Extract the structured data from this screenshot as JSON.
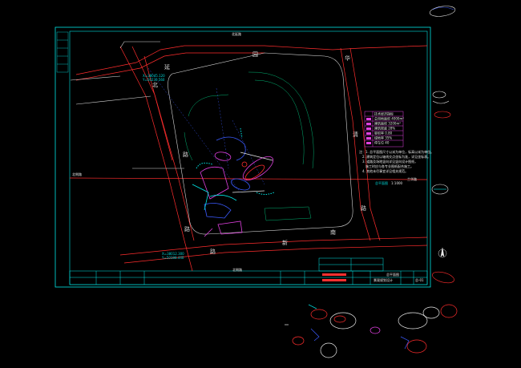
{
  "drawing": {
    "road_labels": [
      "北",
      "延",
      "园",
      "路",
      "华",
      "清",
      "路",
      "新",
      "路",
      "路",
      "南"
    ],
    "street_top": "北延路",
    "street_bottom": "北侧路",
    "street_left": "北侧路",
    "street_right": "兰华路",
    "site_plan_label": "总平面图",
    "site_plan_scale": "1:1000",
    "legend_title": "技术经济指标",
    "legend_rows": [
      "总用地面积 4000m²",
      "建筑面积 3200m²",
      "建筑密度 28%",
      "容积率 0.80",
      "绿地率 35%",
      "停车位 40"
    ],
    "notes": [
      "注：1. 总平面图尺寸以米为单位，标高以米为单位。",
      "2. 建筑定位以轴线交点坐标为准，详见坐标表。",
      "3. 道路及场地竖向详见竖向设计图纸，",
      "施工时应与各专业图纸配合施工。",
      "4. 其他未尽事宜详见相关规范。"
    ],
    "title_block": {
      "project": "景观规划设计",
      "drawing_name": "总平面图",
      "sheet": "总-01",
      "labels": [
        "设计",
        "校对",
        "审核",
        "审定",
        "日期",
        "比例"
      ]
    },
    "coord_labels": [
      "X=38045.120",
      "Y=50230.560",
      "X=38012.300",
      "Y=50188.440"
    ]
  },
  "colors": {
    "frame": "#00e5e5",
    "road": "#ff2d2d",
    "building": "#e040e0",
    "blue": "#3b5bff",
    "white": "#e8e8e8",
    "green": "#00c070"
  }
}
